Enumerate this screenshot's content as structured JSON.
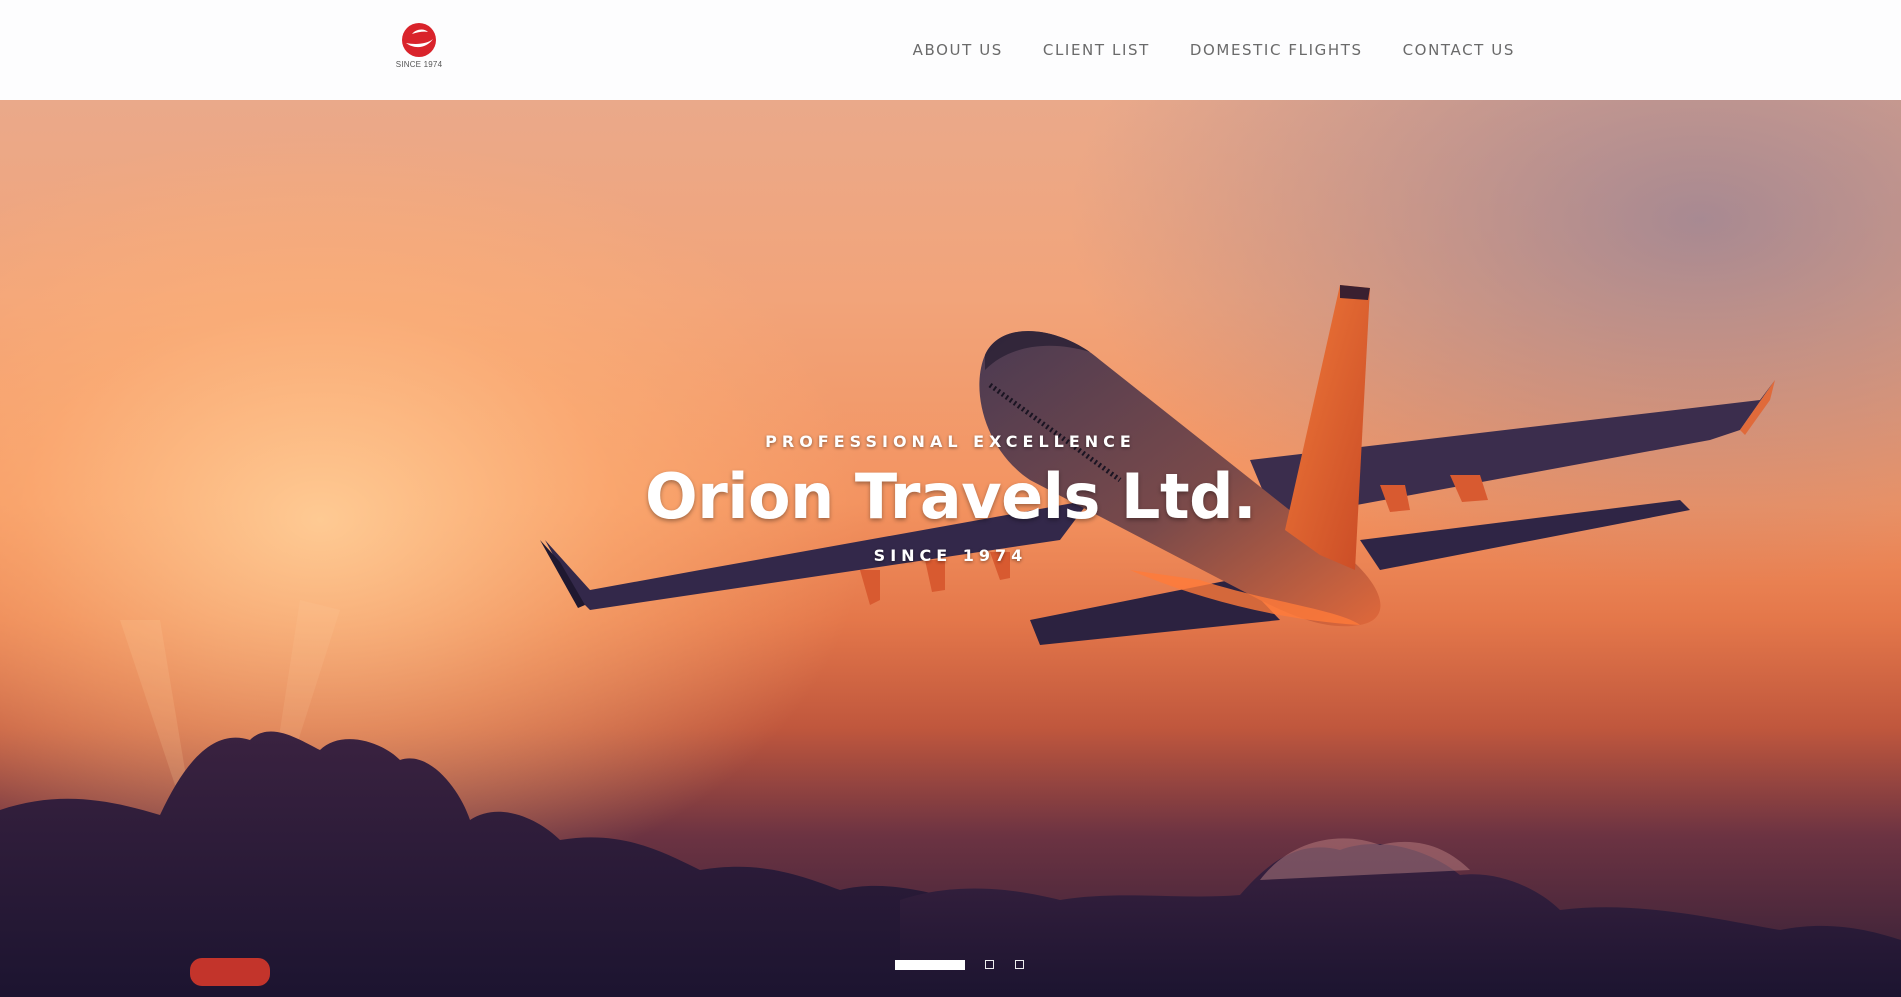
{
  "brand": {
    "logo_text": "SINCE 1974",
    "logo_color": "#d9232b"
  },
  "nav": {
    "items": [
      {
        "label": "ABOUT US"
      },
      {
        "label": "CLIENT LIST"
      },
      {
        "label": "DOMESTIC FLIGHTS"
      },
      {
        "label": "CONTACT US"
      }
    ]
  },
  "hero": {
    "eyebrow": "PROFESSIONAL EXCELLENCE",
    "title": "Orion Travels Ltd.",
    "subtitle": "SINCE 1974",
    "slides": {
      "count": 3,
      "active_index": 0
    }
  }
}
